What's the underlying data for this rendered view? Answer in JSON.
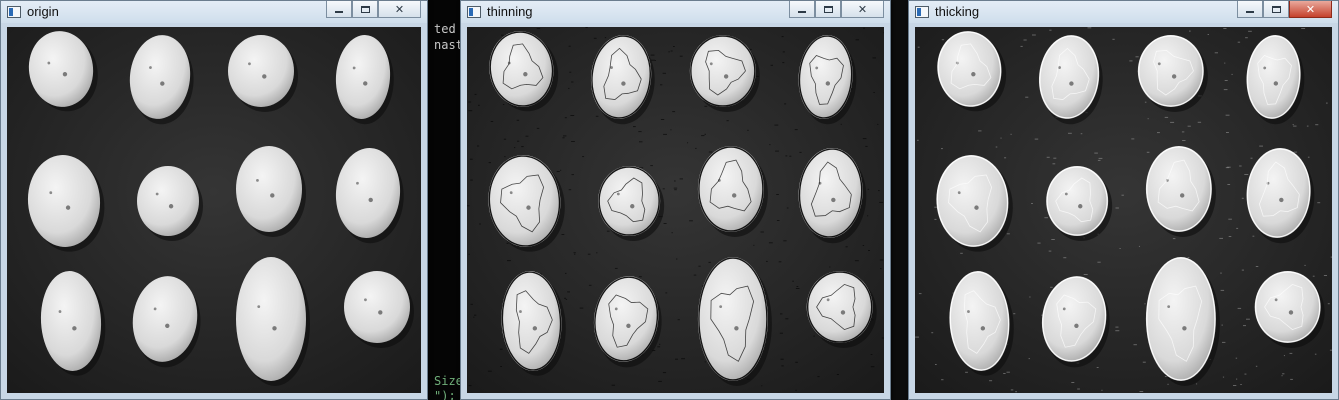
{
  "windows": [
    {
      "title": "origin",
      "variant": "origin"
    },
    {
      "title": "thinning",
      "variant": "thinning"
    },
    {
      "title": "thicking",
      "variant": "thicking"
    }
  ],
  "controls": {
    "minimize": "—",
    "maximize": "☐",
    "close": "✕"
  },
  "console": {
    "lines": [
      "ted",
      "nast",
      "Size",
      "\");"
    ]
  },
  "colors": {
    "titlebar_top": "#e4edf6",
    "frame": "#c8d7e6",
    "background_tray": "#1f1f1f",
    "close_active": "#c5412c",
    "thinning_contour": "#000000",
    "thicking_contour": "#ffffff"
  },
  "icons": [
    "app-window-icon",
    "minimize-icon",
    "maximize-icon",
    "close-icon"
  ]
}
